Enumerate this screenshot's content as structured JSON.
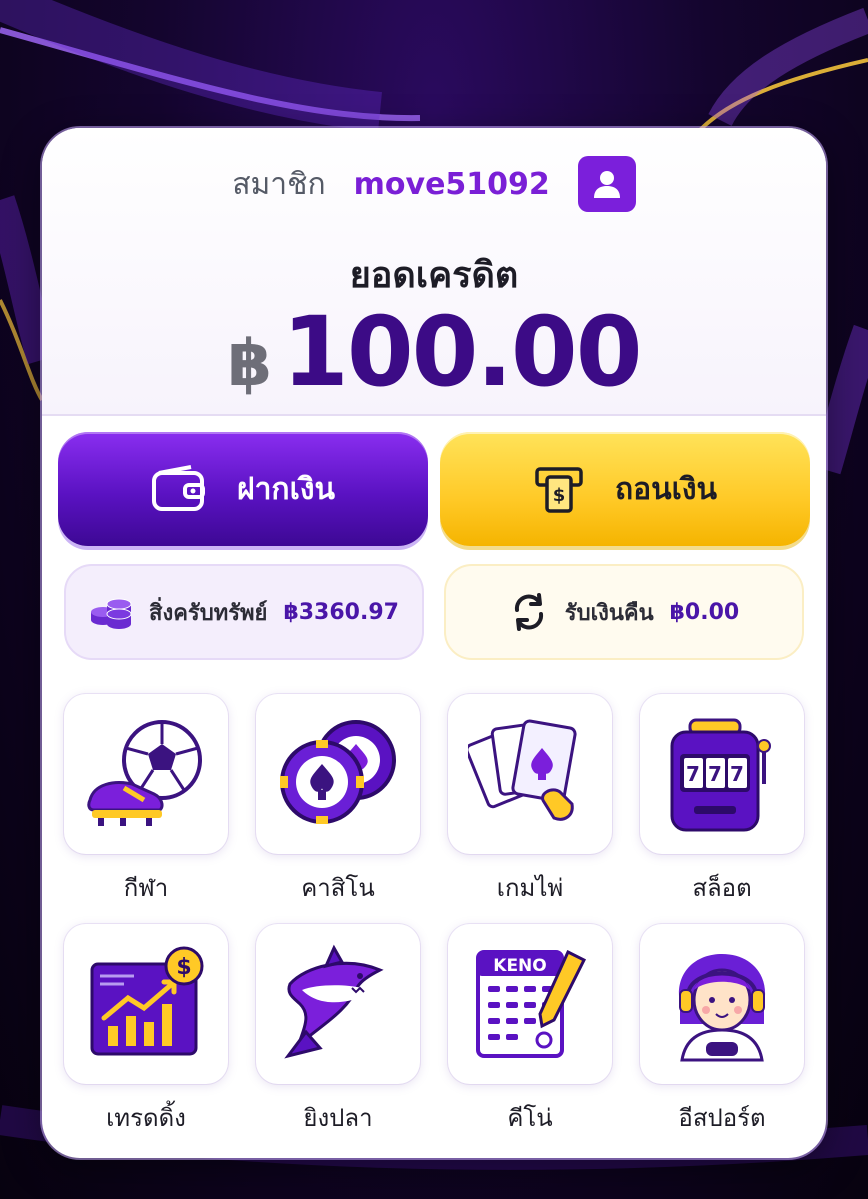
{
  "member": {
    "label": "สมาชิก",
    "username": "move51092"
  },
  "credit": {
    "title": "ยอดเครดิต",
    "currency_symbol": "฿",
    "amount": "100.00"
  },
  "actions": {
    "deposit_label": "ฝากเงิน",
    "withdraw_label": "ถอนเงิน"
  },
  "assets": {
    "label": "สิ่งครับทรัพย์",
    "value": "฿3360.97"
  },
  "cashback": {
    "label": "รับเงินคืน",
    "value": "฿0.00"
  },
  "categories": [
    {
      "label": "กีฬา",
      "icon": "soccer-icon"
    },
    {
      "label": "คาสิโน",
      "icon": "casino-chips-icon"
    },
    {
      "label": "เกมไพ่",
      "icon": "playing-cards-icon"
    },
    {
      "label": "สล็อต",
      "icon": "slot-machine-icon"
    },
    {
      "label": "เทรดดิ้ง",
      "icon": "trading-chart-icon"
    },
    {
      "label": "ยิงปลา",
      "icon": "shark-icon"
    },
    {
      "label": "คีโน่",
      "icon": "keno-ticket-icon",
      "icon_text": "KENO"
    },
    {
      "label": "อีสปอร์ต",
      "icon": "esports-gamer-icon"
    }
  ],
  "colors": {
    "brand_purple": "#7b1fdb",
    "dark_purple": "#3c0b86",
    "gold": "#ffc926"
  }
}
